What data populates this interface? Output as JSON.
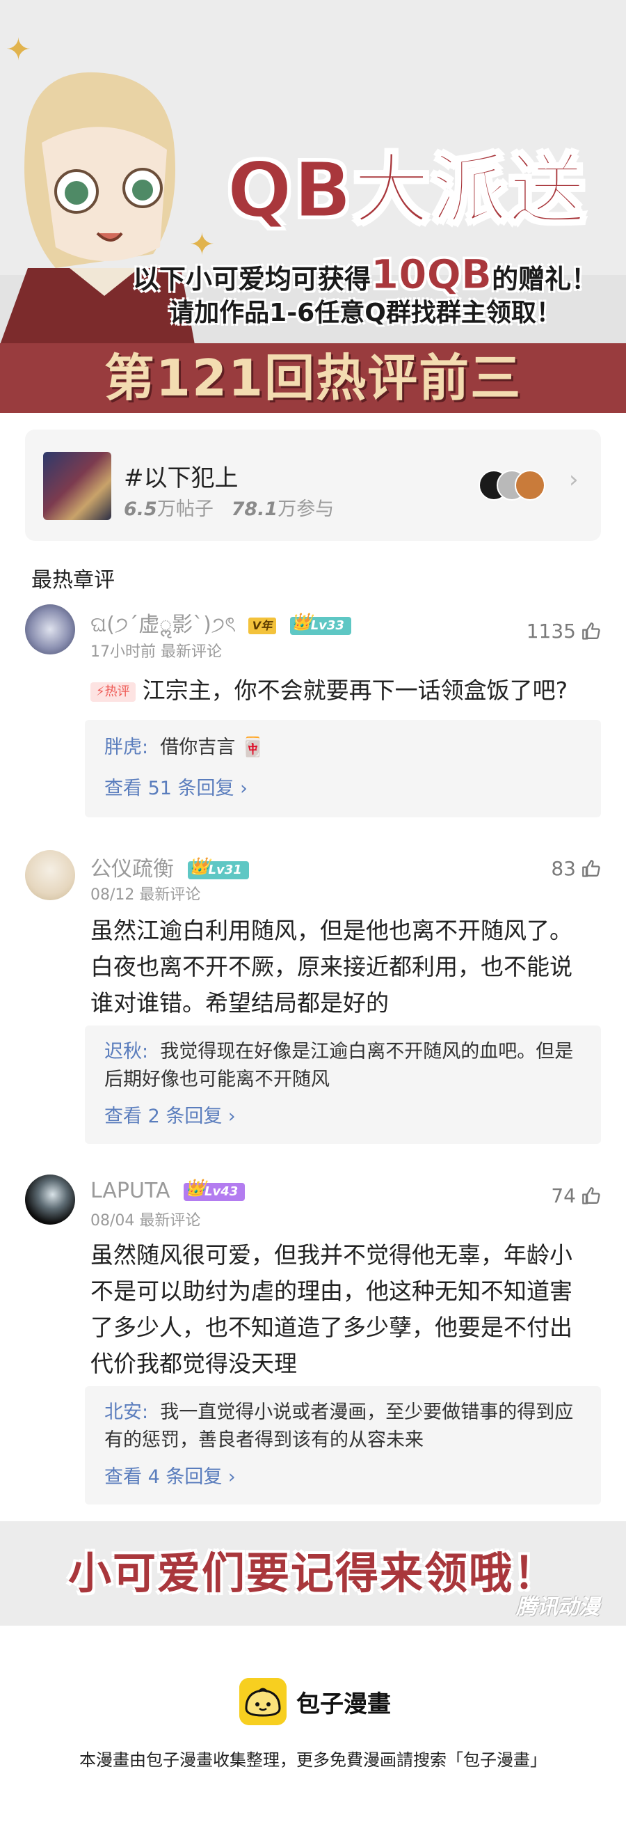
{
  "banner": {
    "title": "QB大派送",
    "gift_prefix": "以下小可爱均可获得",
    "gift_amount": "10QB",
    "gift_suffix": "的赠礼！",
    "join_text": "请加作品1-6任意Q群找群主领取！",
    "round_title": "第121回热评前三"
  },
  "topic": {
    "name": "#以下犯上",
    "posts_value": "6.5",
    "posts_label": "万帖子",
    "participants_value": "78.1",
    "participants_label": "万参与"
  },
  "section_title": "最热章评",
  "comments": [
    {
      "username": "ଘ(੭ˊ虚ॢ影ˋ)੭ৎ",
      "vip_badge": "V年",
      "level": "Lv33",
      "time": "17小时前",
      "meta_label": "最新评论",
      "likes": "1135",
      "hot_tag": "热评",
      "text": "江宗主，你不会就要再下一话领盒饭了吧?",
      "reply_author": "胖虎:",
      "reply_text": "借你吉言 🀄",
      "more_replies": "查看 51 条回复 ›"
    },
    {
      "username": "公仪疏衡",
      "level": "Lv31",
      "time": "08/12",
      "meta_label": "最新评论",
      "likes": "83",
      "text": "虽然江逾白利用随风，但是他也离不开随风了。白夜也离不开不厥，原来接近都利用，也不能说谁对谁错。希望结局都是好的",
      "reply_author": "迟秋:",
      "reply_text": "我觉得现在好像是江逾白离不开随风的血吧。但是后期好像也可能离不开随风",
      "more_replies": "查看 2 条回复 ›"
    },
    {
      "username": "LAPUTA",
      "level": "Lv43",
      "time": "08/04",
      "meta_label": "最新评论",
      "likes": "74",
      "text": "虽然随风很可爱，但我并不觉得他无辜，年龄小不是可以助纣为虐的理由，他这种无知不知道害了多少人，也不知道造了多少孽，他要是不付出代价我都觉得没天理",
      "reply_author": "北安:",
      "reply_text": "我一直觉得小说或者漫画，至少要做错事的得到应有的惩罚，善良者得到该有的从容未来",
      "more_replies": "查看 4 条回复 ›"
    }
  ],
  "footer": {
    "slogan": "小可爱们要记得来领哦！",
    "watermark": "腾讯动漫",
    "brand_name": "包子漫畫",
    "disclaimer": "本漫畫由包子漫畫收集整理，更多免費漫画請搜索「包子漫畫」"
  },
  "colors": {
    "brand_red": "#a9373c",
    "bar_red": "#993c3e",
    "bar_text": "#f3dcb1",
    "link_blue": "#5a7dbd",
    "level_teal": "#5ec7c4",
    "level_purple": "#b37cf0",
    "logo_yellow": "#f7cf20"
  }
}
